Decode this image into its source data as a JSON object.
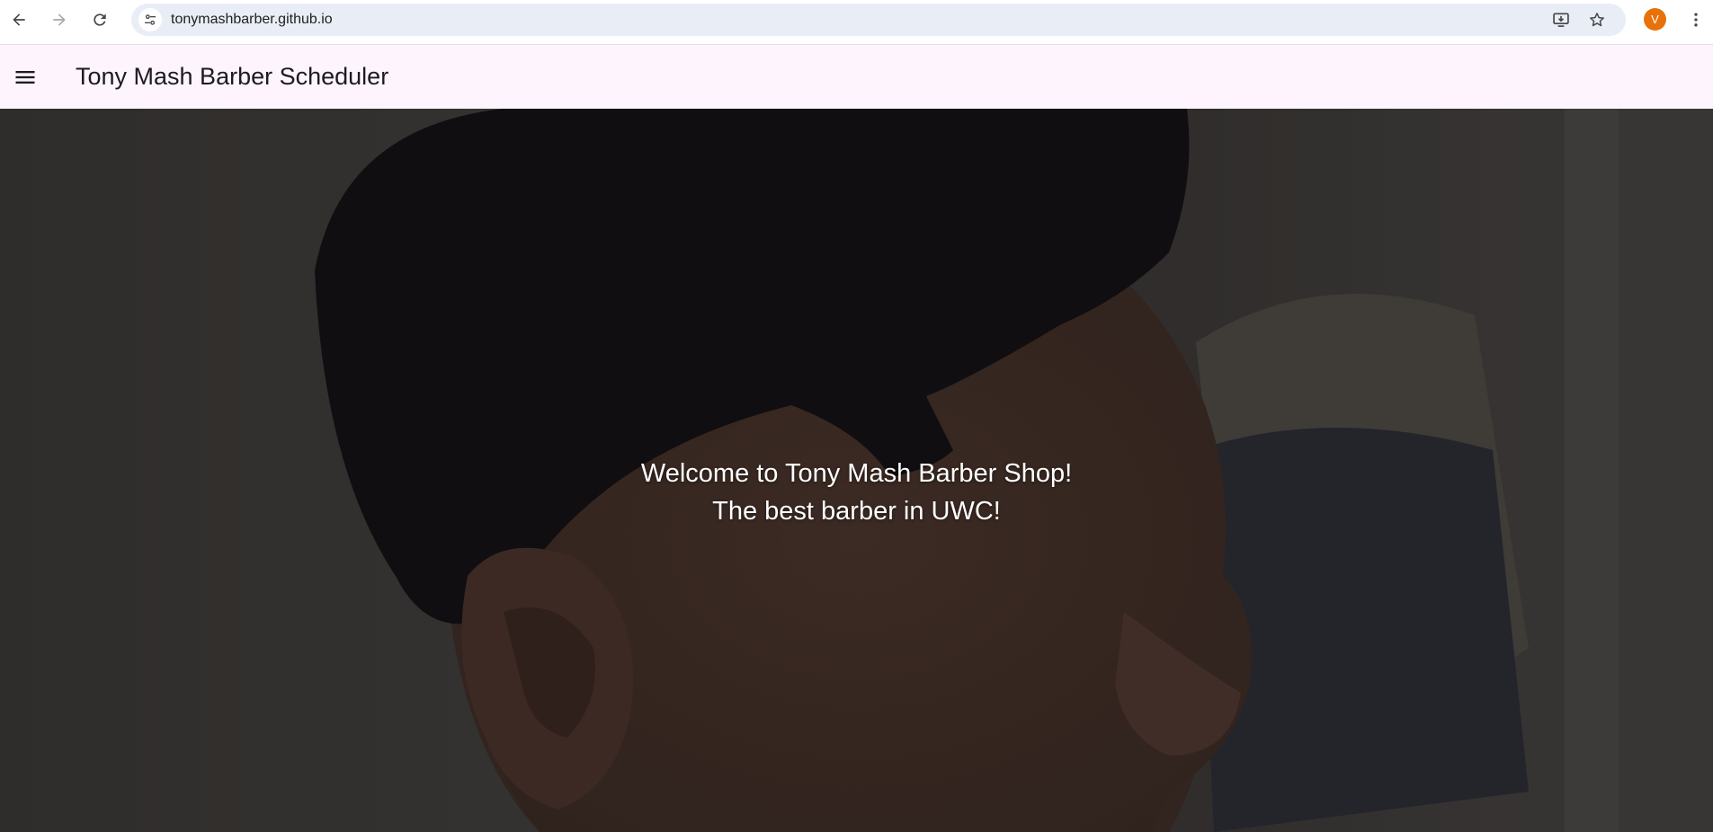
{
  "browser": {
    "url": "tonymashbarber.github.io",
    "profile_initial": "V",
    "profile_color": "#e8710a",
    "icons": {
      "back": "arrow-left-icon",
      "forward": "arrow-right-icon",
      "reload": "reload-icon",
      "site_info": "tune-icon",
      "install": "install-app-icon",
      "bookmark": "star-icon",
      "menu": "more-vert-icon"
    }
  },
  "app_bar": {
    "title": "Tony Mash Barber Scheduler",
    "background": "#fdf4fd",
    "menu_icon": "hamburger-menu-icon"
  },
  "hero": {
    "line1": "Welcome to Tony Mash Barber Shop!",
    "line2": "The best barber in UWC!",
    "text_color": "#ffffff"
  }
}
